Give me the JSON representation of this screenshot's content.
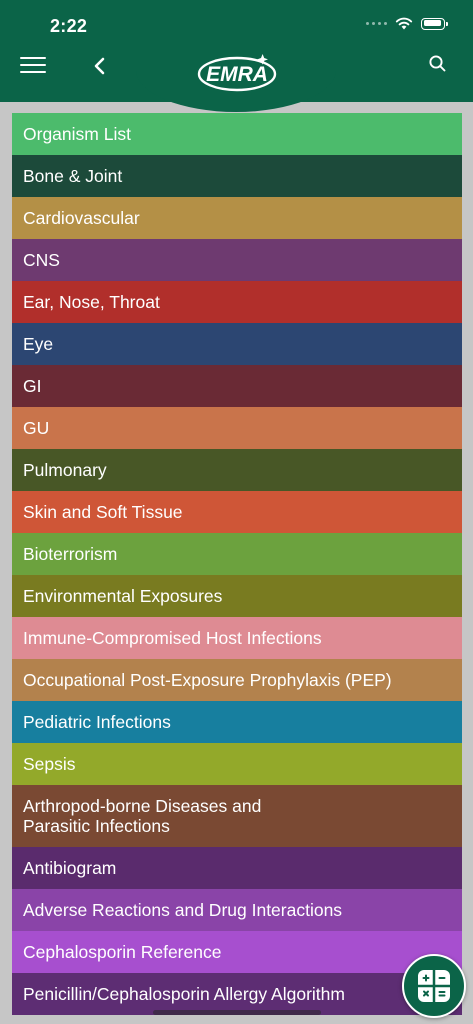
{
  "status_bar": {
    "time": "2:22"
  },
  "header": {
    "logo_text": "EMRA",
    "icons": [
      "menu-icon",
      "back-chevron-icon",
      "search-icon"
    ]
  },
  "list": [
    {
      "label": "Organism List",
      "color": "#4cbb6c"
    },
    {
      "label": "Bone & Joint",
      "color": "#1c4a3a"
    },
    {
      "label": "Cardiovascular",
      "color": "#b49046"
    },
    {
      "label": "CNS",
      "color": "#6e3a70"
    },
    {
      "label": "Ear, Nose, Throat",
      "color": "#b12f2b"
    },
    {
      "label": "Eye",
      "color": "#2c4672"
    },
    {
      "label": "GI",
      "color": "#6a2a35"
    },
    {
      "label": "GU",
      "color": "#c9744b"
    },
    {
      "label": "Pulmonary",
      "color": "#485726"
    },
    {
      "label": "Skin and Soft Tissue",
      "color": "#cf5637"
    },
    {
      "label": "Bioterrorism",
      "color": "#6ca23e"
    },
    {
      "label": "Environmental Exposures",
      "color": "#797b20"
    },
    {
      "label": "Immune-Compromised Host Infections",
      "color": "#de8b93"
    },
    {
      "label": "Occupational Post-Exposure Prophylaxis (PEP)",
      "color": "#b3824d"
    },
    {
      "label": "Pediatric Infections",
      "color": "#177f9f"
    },
    {
      "label": "Sepsis",
      "color": "#93a92a"
    },
    {
      "label": "Arthropod-borne Diseases and Parasitic Infections",
      "color": "#7a4933"
    },
    {
      "label": "Antibiogram",
      "color": "#5a2b6d"
    },
    {
      "label": "Adverse Reactions and Drug Interactions",
      "color": "#8a44a8"
    },
    {
      "label": "Cephalosporin Reference",
      "color": "#a74fcf"
    },
    {
      "label": "Penicillin/Cephalosporin Allergy Algorithm",
      "color": "#5d2d73"
    }
  ],
  "fab": {
    "icon": "calculator-icon",
    "color": "#0b6448"
  }
}
